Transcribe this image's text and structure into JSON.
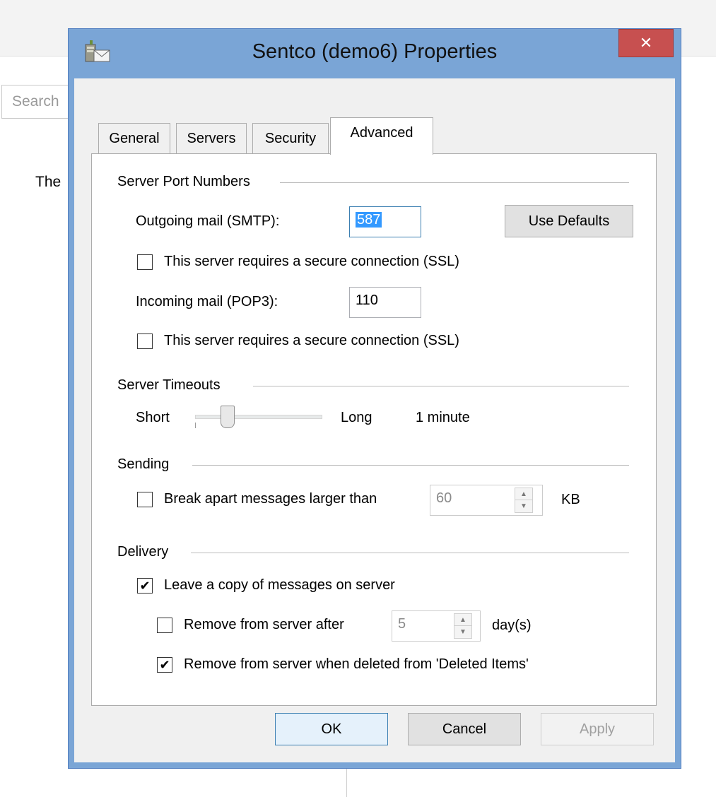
{
  "background": {
    "search_placeholder": "Search",
    "text_fragment": "The"
  },
  "dialog": {
    "title": "Sentco (demo6) Properties",
    "close_glyph": "✕",
    "tabs": [
      {
        "label": "General",
        "active": false
      },
      {
        "label": "Servers",
        "active": false
      },
      {
        "label": "Security",
        "active": false
      },
      {
        "label": "Advanced",
        "active": true
      }
    ],
    "ports": {
      "group_label": "Server Port Numbers",
      "outgoing_label": "Outgoing mail (SMTP):",
      "outgoing_value": "587",
      "use_defaults_label": "Use Defaults",
      "outgoing_ssl_label": "This server requires a secure connection (SSL)",
      "outgoing_ssl_checked": false,
      "incoming_label": "Incoming mail (POP3):",
      "incoming_value": "110",
      "incoming_ssl_label": "This server requires a secure connection (SSL)",
      "incoming_ssl_checked": false
    },
    "timeouts": {
      "group_label": "Server Timeouts",
      "short_label": "Short",
      "long_label": "Long",
      "value_text": "1 minute",
      "slider_fraction": 0.15
    },
    "sending": {
      "group_label": "Sending",
      "break_label": "Break apart messages larger than",
      "break_checked": false,
      "size_value": "60",
      "unit_label": "KB"
    },
    "delivery": {
      "group_label": "Delivery",
      "leave_copy_label": "Leave a copy of messages on server",
      "leave_copy_checked": true,
      "remove_after_label": "Remove from server after",
      "remove_after_checked": false,
      "days_value": "5",
      "days_unit": "day(s)",
      "remove_deleted_label": "Remove from server when deleted from 'Deleted Items'",
      "remove_deleted_checked": true
    },
    "buttons": {
      "ok": "OK",
      "cancel": "Cancel",
      "apply": "Apply"
    },
    "check_glyph": "✔"
  },
  "colors": {
    "frame": "#7aa5d6",
    "close": "#c75050",
    "selection": "#3399ff"
  }
}
